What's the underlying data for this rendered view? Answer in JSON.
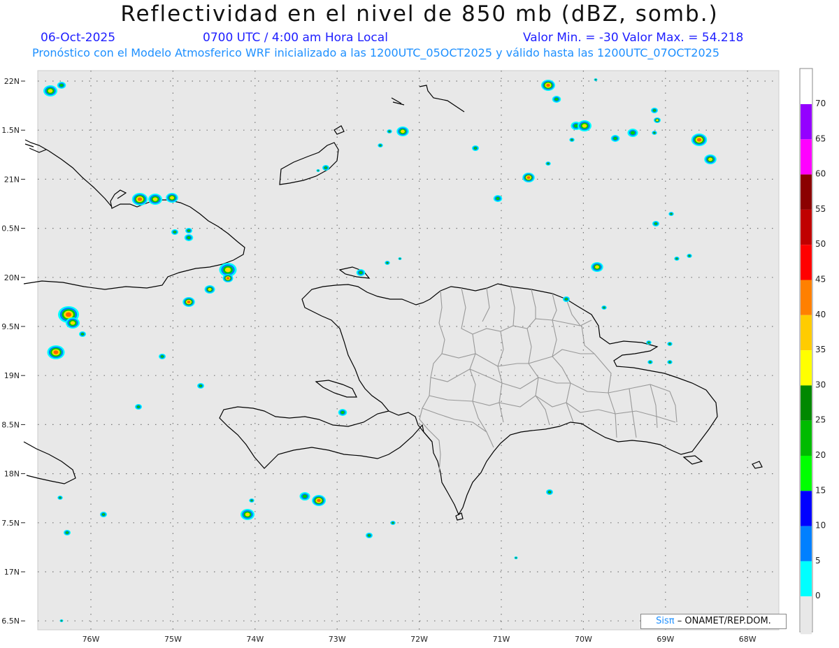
{
  "header": {
    "title": "Reflectividad en el nivel de 850 mb (dBZ, somb.)",
    "date": "06-Oct-2025",
    "time": "0700 UTC / 4:00 am Hora Local",
    "minmax": "Valor Min. = -30  Valor Max. = 54.218",
    "model_line": "Pronóstico con el Modelo Atmosferico WRF inicializado a las 1200UTC_05OCT2025 y válido hasta las  1200UTC_07OCT2025"
  },
  "axes": {
    "lon_labels": [
      "76W",
      "75W",
      "74W",
      "73W",
      "72W",
      "71W",
      "70W",
      "69W",
      "68W"
    ],
    "lat_labels": [
      "22N",
      "1.5N",
      "21N",
      "0.5N",
      "20N",
      "9.5N",
      "19N",
      "8.5N",
      "18N",
      "7.5N",
      "17N",
      "6.5N"
    ]
  },
  "colorbar": {
    "labels": [
      "70",
      "65",
      "60",
      "55",
      "50",
      "45",
      "40",
      "35",
      "30",
      "25",
      "20",
      "15",
      "10",
      "5",
      "0"
    ],
    "colors": [
      "#9400ff",
      "#ff00ff",
      "#8b0000",
      "#c00000",
      "#ff0000",
      "#ff8000",
      "#ffcc00",
      "#ffff00",
      "#008800",
      "#00bb00",
      "#00ff00",
      "#0000ff",
      "#0080ff",
      "#00ffff",
      "#e8e8e8"
    ]
  },
  "credit": {
    "logo": "Sisπ",
    "text": "– ONAMET/REP.DOM."
  },
  "colors": {
    "map_bg": "#e8e8e8",
    "grid": "#777777",
    "coast": "#000000",
    "provinces": "#999999"
  }
}
